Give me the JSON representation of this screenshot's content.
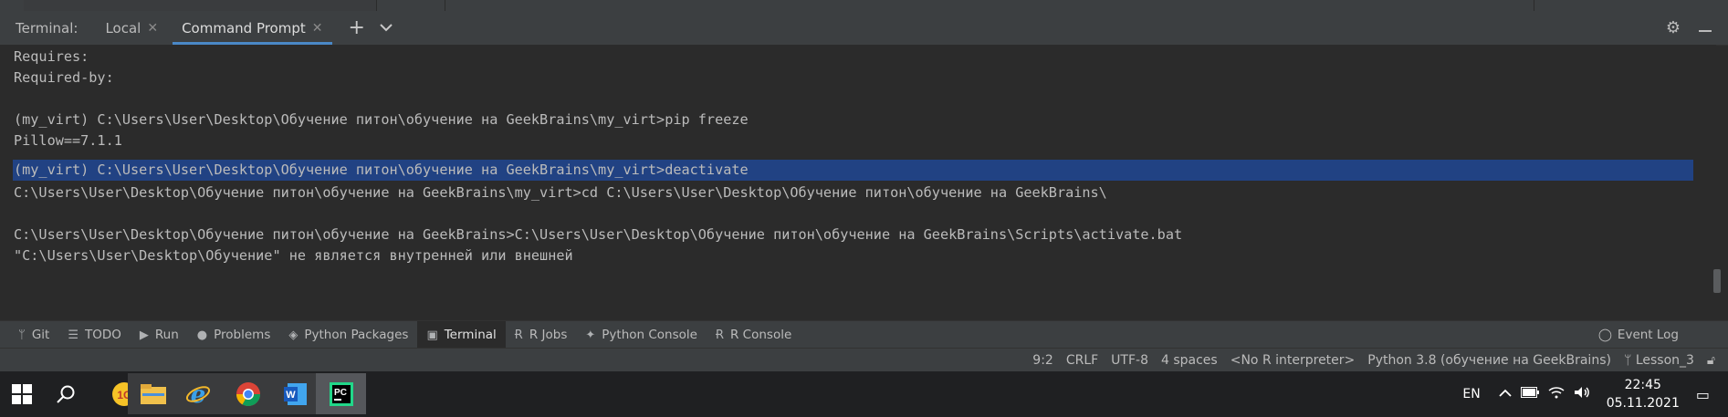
{
  "terminal": {
    "label": "Terminal:",
    "tabs": [
      {
        "label": "Local",
        "active": false
      },
      {
        "label": "Command Prompt",
        "active": true
      }
    ],
    "new_tab": "+",
    "lines": [
      "Requires:",
      "Required-by:",
      "",
      "(my_virt) C:\\Users\\User\\Desktop\\Обучение питон\\обучение на GeekBrains\\my_virt>pip freeze",
      "Pillow==7.1.1",
      "",
      "(my_virt) C:\\Users\\User\\Desktop\\Обучение питон\\обучение на GeekBrains\\my_virt>deactivate",
      "C:\\Users\\User\\Desktop\\Обучение питон\\обучение на GeekBrains\\my_virt>cd C:\\Users\\User\\Desktop\\Обучение питон\\обучение на GeekBrains\\",
      "",
      "C:\\Users\\User\\Desktop\\Обучение питон\\обучение на GeekBrains>C:\\Users\\User\\Desktop\\Обучение питон\\обучение на GeekBrains\\Scripts\\activate.bat",
      "\"C:\\Users\\User\\Desktop\\Обучение\" не является внутренней или внешней"
    ],
    "selected_line_index": 6
  },
  "tools": {
    "items": [
      {
        "label": "Git",
        "icon": "git-branch-icon"
      },
      {
        "label": "TODO",
        "icon": "list-icon"
      },
      {
        "label": "Run",
        "icon": "play-icon"
      },
      {
        "label": "Problems",
        "icon": "warning-icon"
      },
      {
        "label": "Python Packages",
        "icon": "layers-icon"
      },
      {
        "label": "Terminal",
        "icon": "terminal-icon",
        "active": true
      },
      {
        "label": "R Jobs",
        "icon": "r-icon"
      },
      {
        "label": "Python Console",
        "icon": "python-icon"
      },
      {
        "label": "R Console",
        "icon": "r-icon"
      }
    ],
    "event_log": "Event Log"
  },
  "status": {
    "position": "9:2",
    "line_sep": "CRLF",
    "encoding": "UTF-8",
    "indent": "4 spaces",
    "r_interpreter": "<No R interpreter>",
    "python": "Python 3.8 (обучение на GeekBrains)",
    "branch": "Lesson_3"
  },
  "taskbar": {
    "lang": "EN",
    "time": "22:45",
    "date": "05.11.2021",
    "apps": [
      "1c-icon",
      "file-explorer-icon",
      "internet-explorer-icon",
      "chrome-icon",
      "word-icon",
      "pycharm-icon"
    ]
  },
  "colors": {
    "selection": "#214283",
    "active_tab_underline": "#4a88c7",
    "panel": "#3c3f41",
    "editor_bg": "#2b2b2b"
  }
}
